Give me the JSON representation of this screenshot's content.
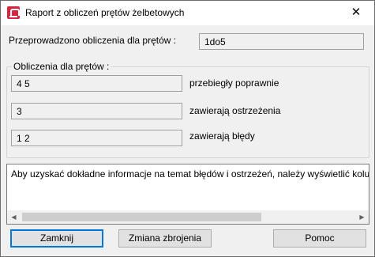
{
  "window": {
    "title": "Raport z obliczeń prętów żelbetowych",
    "close_glyph": "✕"
  },
  "summary": {
    "label": "Przeprowadzono obliczenia dla prętów :",
    "value": "1do5"
  },
  "group": {
    "title": "Obliczenia dla prętów :",
    "rows": [
      {
        "value": "4 5",
        "label": "przebiegły poprawnie"
      },
      {
        "value": "3",
        "label": "zawierają ostrzeżenia"
      },
      {
        "value": "1 2",
        "label": "zawierają błędy"
      }
    ]
  },
  "message": {
    "text": "Aby uzyskać dokładne informacje na temat błędów i ostrzeżeń, należy wyświetlić kolumnę 'Uwagi' w tabeli",
    "scroll_left_glyph": "◀",
    "scroll_right_glyph": "▶"
  },
  "buttons": {
    "close": "Zamknij",
    "change_reinforcement": "Zmiana zbrojenia",
    "help": "Pomoc"
  },
  "icons": {
    "app": "robot-app-icon",
    "close": "close-icon"
  }
}
